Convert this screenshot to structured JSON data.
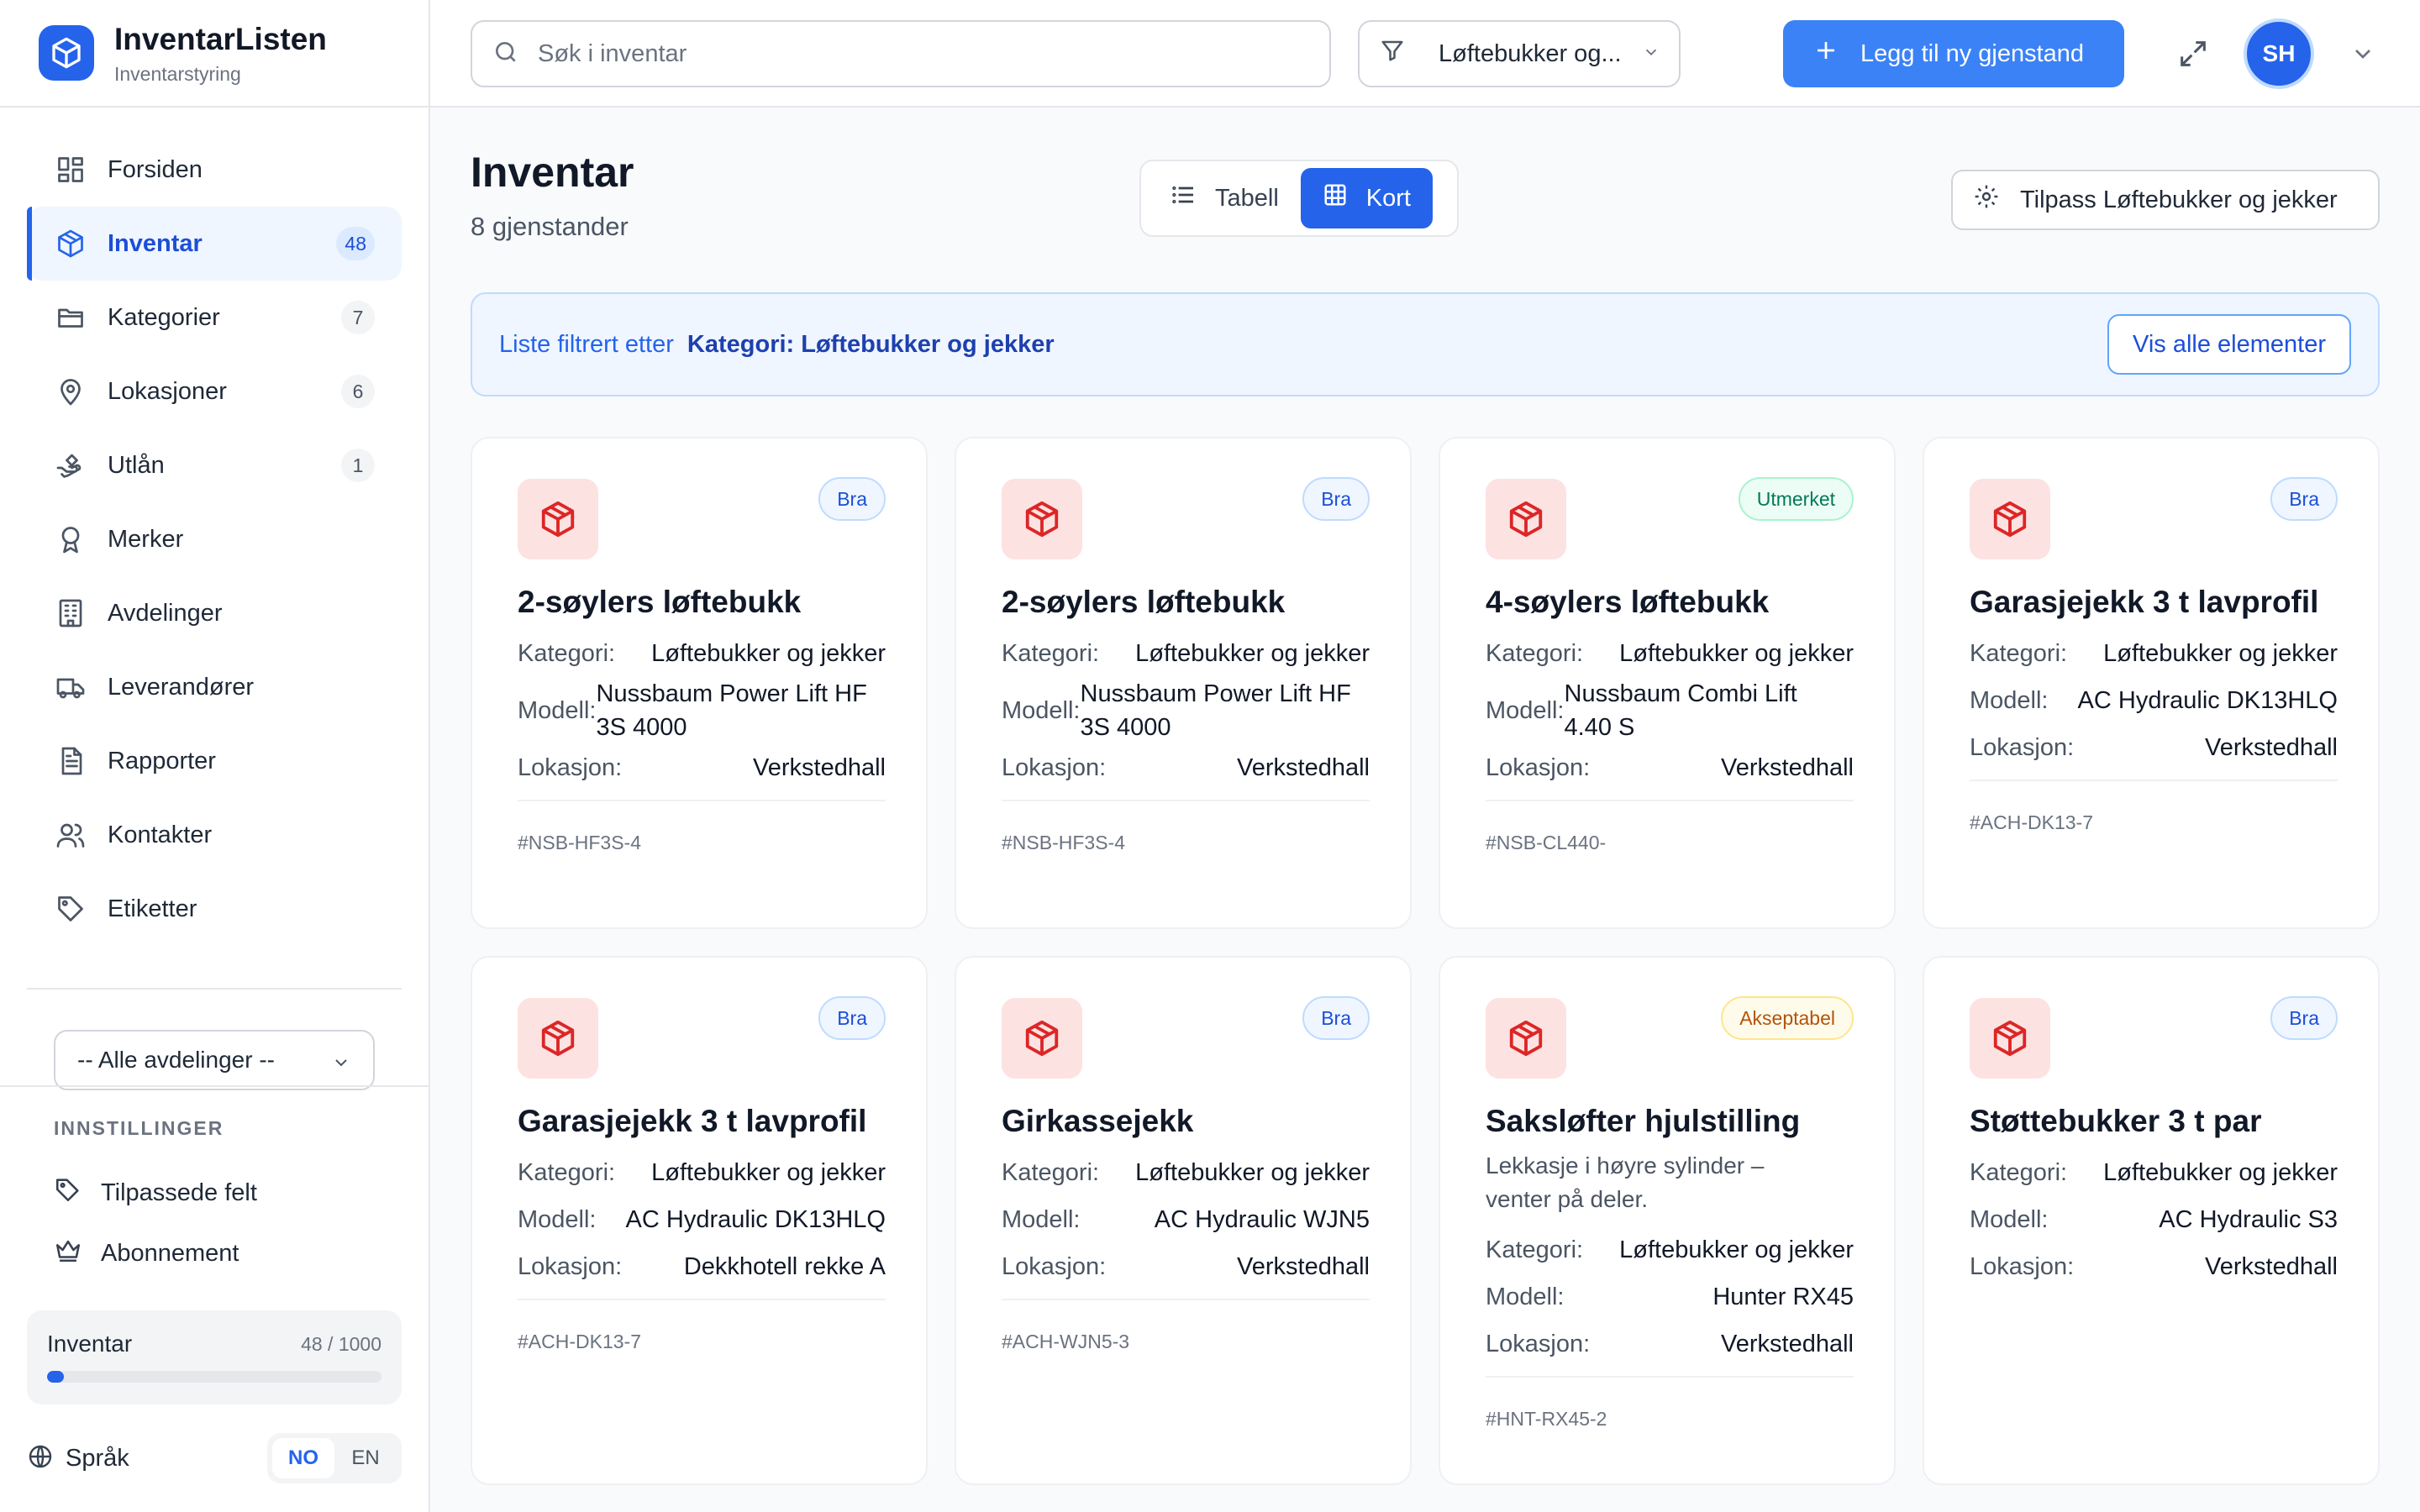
{
  "brand": {
    "title": "InventarListen",
    "subtitle": "Inventarstyring"
  },
  "nav": [
    {
      "label": "Forsiden",
      "icon": "dashboard-icon",
      "count": null,
      "active": false
    },
    {
      "label": "Inventar",
      "icon": "box-icon",
      "count": "48",
      "active": true
    },
    {
      "label": "Kategorier",
      "icon": "folder-icon",
      "count": "7",
      "active": false
    },
    {
      "label": "Lokasjoner",
      "icon": "map-pin-icon",
      "count": "6",
      "active": false
    },
    {
      "label": "Utlån",
      "icon": "hand-loan-icon",
      "count": "1",
      "active": false
    },
    {
      "label": "Merker",
      "icon": "award-icon",
      "count": null,
      "active": false
    },
    {
      "label": "Avdelinger",
      "icon": "building-icon",
      "count": null,
      "active": false
    },
    {
      "label": "Leverandører",
      "icon": "truck-icon",
      "count": null,
      "active": false
    },
    {
      "label": "Rapporter",
      "icon": "report-icon",
      "count": null,
      "active": false
    },
    {
      "label": "Kontakter",
      "icon": "users-icon",
      "count": null,
      "active": false
    },
    {
      "label": "Etiketter",
      "icon": "tag-icon",
      "count": null,
      "active": false
    }
  ],
  "department_select": {
    "value": "-- Alle avdelinger --"
  },
  "settings": {
    "heading": "INNSTILLINGER",
    "custom_fields": "Tilpassede felt",
    "subscription": "Abonnement"
  },
  "usage": {
    "label": "Inventar",
    "count_text": "48 / 1000",
    "fraction": 0.048
  },
  "language": {
    "label": "Språk",
    "options": [
      "NO",
      "EN"
    ],
    "selected": "NO"
  },
  "topbar": {
    "search_placeholder": "Søk i inventar",
    "filter_label": "Løftebukker og...",
    "add_button": "Legg til ny gjenstand",
    "avatar_initials": "SH"
  },
  "page": {
    "title": "Inventar",
    "subtitle": "8 gjenstander",
    "view_table": "Tabell",
    "view_cards": "Kort",
    "customize_button": "Tilpass Løftebukker og jekker"
  },
  "filter_banner": {
    "text": "Liste filtrert etter",
    "value": "Kategori: Løftebukker og jekker",
    "show_all": "Vis alle elementer"
  },
  "labels": {
    "category": "Kategori:",
    "model": "Modell:",
    "location": "Lokasjon:"
  },
  "items": [
    {
      "title": "2-søylers løftebukk",
      "status": "Bra",
      "status_type": "good",
      "note": "",
      "category": "Løftebukker og jekker",
      "model": "Nussbaum Power Lift HF 3S 4000",
      "model_wrap": true,
      "location": "Verkstedhall",
      "id": "#NSB-HF3S-4"
    },
    {
      "title": "2-søylers løftebukk",
      "status": "Bra",
      "status_type": "good",
      "note": "",
      "category": "Løftebukker og jekker",
      "model": "Nussbaum Power Lift HF 3S 4000",
      "model_wrap": true,
      "location": "Verkstedhall",
      "id": "#NSB-HF3S-4"
    },
    {
      "title": "4-søylers løftebukk",
      "status": "Utmerket",
      "status_type": "excellent",
      "note": "",
      "category": "Løftebukker og jekker",
      "model": "Nussbaum Combi Lift 4.40 S",
      "model_wrap": true,
      "location": "Verkstedhall",
      "id": "#NSB-CL440-"
    },
    {
      "title": "Garasjejekk 3 t lavprofil",
      "status": "Bra",
      "status_type": "good",
      "note": "",
      "category": "Løftebukker og jekker",
      "model": "AC Hydraulic DK13HLQ",
      "model_wrap": false,
      "location": "Verkstedhall",
      "id": "#ACH-DK13-7"
    },
    {
      "title": "Garasjejekk 3 t lavprofil",
      "status": "Bra",
      "status_type": "good",
      "note": "",
      "category": "Løftebukker og jekker",
      "model": "AC Hydraulic DK13HLQ",
      "model_wrap": false,
      "location": "Dekkhotell rekke A",
      "id": "#ACH-DK13-7"
    },
    {
      "title": "Girkassejekk",
      "status": "Bra",
      "status_type": "good",
      "note": "",
      "category": "Løftebukker og jekker",
      "model": "AC Hydraulic WJN5",
      "model_wrap": false,
      "location": "Verkstedhall",
      "id": "#ACH-WJN5-3"
    },
    {
      "title": "Saksløfter hjulstilling",
      "status": "Akseptabel",
      "status_type": "ok",
      "note": "Lekkasje i høyre sylinder – venter på deler.",
      "category": "Løftebukker og jekker",
      "model": "Hunter RX45",
      "model_wrap": false,
      "location": "Verkstedhall",
      "id": "#HNT-RX45-2"
    },
    {
      "title": "Støttebukker 3 t par",
      "status": "Bra",
      "status_type": "good",
      "note": "",
      "category": "Løftebukker og jekker",
      "model": "AC Hydraulic S3",
      "model_wrap": false,
      "location": "Verkstedhall",
      "id": ""
    }
  ],
  "colors": {
    "primary": "#2563eb",
    "button_blue": "#3b82f6",
    "item_icon_bg": "#fde2e2",
    "item_icon": "#dc2626"
  }
}
